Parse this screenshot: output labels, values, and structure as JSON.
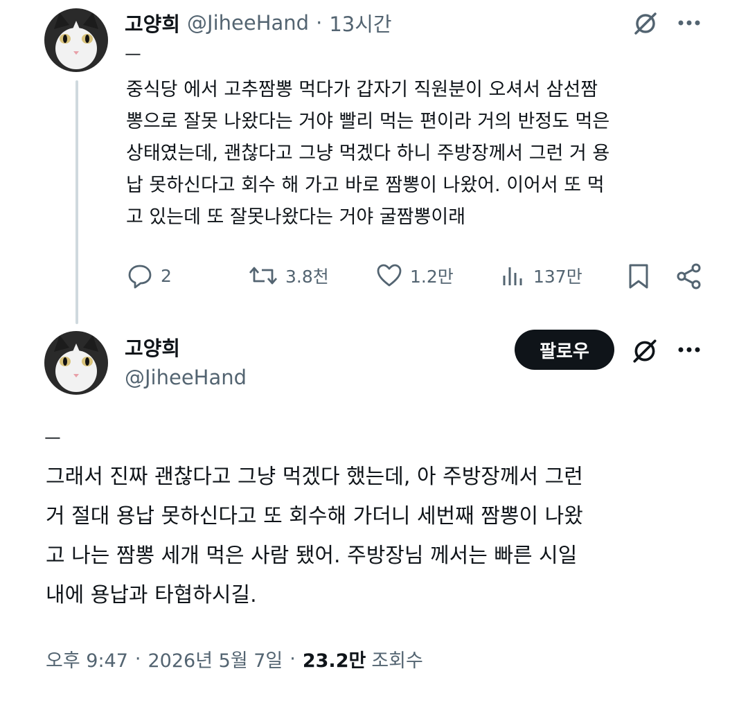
{
  "tweet1": {
    "name": "고양희",
    "handle": "@JiheeHand",
    "sep": "·",
    "time": "13시간",
    "dash": "ㅡ",
    "text_lines": [
      "중식당 에서 고추짬뽕 먹다가 갑자기 직원분이 오셔서 삼선짬",
      "뽕으로 잘못 나왔다는 거야 빨리 먹는 편이라 거의 반정도 먹은",
      "상태였는데, 괜찮다고 그냥 먹겠다 하니 주방장께서 그런 거 용",
      "납 못하신다고 회수 해 가고 바로 짬뽕이 나왔어. 이어서 또 먹",
      "고 있는데 또 잘못나왔다는 거야 굴짬뽕이래"
    ],
    "actions": {
      "replies": "2",
      "reposts": "3.8천",
      "likes": "1.2만",
      "views": "137만"
    }
  },
  "tweet2": {
    "name": "고양희",
    "handle": "@JiheeHand",
    "follow_label": "팔로우",
    "dash": "ㅡ",
    "text_lines": [
      "그래서 진짜 괜찮다고 그냥 먹겠다 했는데, 아 주방장께서 그런",
      "거 절대 용납 못하신다고 또 회수해 가더니 세번째 짬뽕이 나왔",
      "고 나는 짬뽕 세개 먹은 사람 됐어. 주방장님 께서는 빠른 시일",
      "내에 용납과 타협하시길."
    ],
    "meta": {
      "time": "오후 9:47",
      "sep1": "·",
      "date": "2026년 5월 7일",
      "sep2": "·",
      "views_count": "23.2만",
      "views_label": "조회수"
    }
  },
  "icons": {
    "grok": "grok-icon",
    "more": "more-icon",
    "reply": "reply-icon",
    "repost": "repost-icon",
    "like": "like-icon",
    "views": "views-icon",
    "bookmark": "bookmark-icon",
    "share": "share-icon"
  },
  "colors": {
    "text": "#0f1419",
    "muted": "#536471",
    "thread_line": "#cfd9de",
    "follow_bg": "#0f1419"
  }
}
